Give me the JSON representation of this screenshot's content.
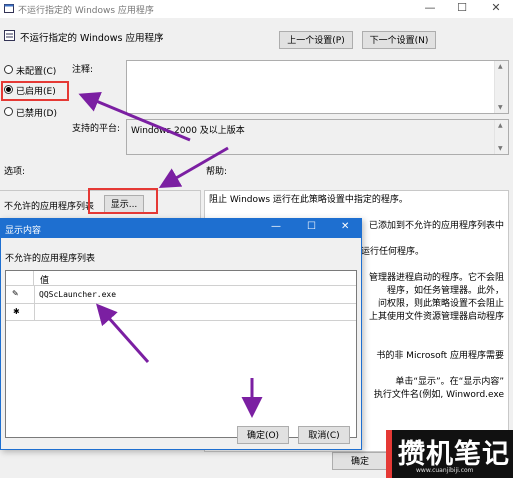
{
  "window": {
    "title": "不运行指定的 Windows 应用程序",
    "minimize_glyph": "—",
    "maximize_glyph": "☐",
    "close_glyph": "✕"
  },
  "policy": {
    "heading": "不运行指定的 Windows 应用程序",
    "prev_setting_label": "上一个设置(P)",
    "next_setting_label": "下一个设置(N)",
    "radio_options": [
      {
        "label": "未配置(C)",
        "selected": false
      },
      {
        "label": "已启用(E)",
        "selected": true
      },
      {
        "label": "已禁用(D)",
        "selected": false
      }
    ],
    "comment_label": "注释:",
    "platform_label": "支持的平台:",
    "platform_value": "Windows 2000 及以上版本",
    "options_label": "选项:",
    "help_label": "帮助:",
    "disallowed_list_label": "不允许的应用程序列表",
    "show_button_label": "显示...",
    "help_text_lines": [
      "阻止 Windows 运行在此策略设置中指定的程序。",
      "",
      "已添加到不允许的应用程序列表中",
      "",
      "可以运行任何程序。",
      "",
      "管理器进程启动的程序。它不会阻",
      "程序，如任务管理器。此外，",
      "问权限，则此策略设置不会阻止",
      "上其使用文件资源管理器启动程序",
      "",
      "",
      "书的非 Microsoft 应用程序需要",
      "",
      "单击“显示”。在“显示内容”",
      "执行文件名(例如, Winword.exe"
    ],
    "ok_label": "确定"
  },
  "dialog": {
    "title": "显示内容",
    "list_label": "不允许的应用程序列表",
    "column_header": "值",
    "rows": [
      {
        "marker": "✎",
        "value": "QQScLauncher.exe"
      },
      {
        "marker": "✱",
        "value": ""
      }
    ],
    "ok_label": "确定(O)",
    "cancel_label": "取消(C)",
    "minimize_glyph": "—",
    "maximize_glyph": "☐",
    "close_glyph": "✕"
  },
  "watermark": {
    "text": "攒机笔记",
    "url": "www.cuanjibiji.com"
  },
  "colors": {
    "accent_blue": "#1e6fd0",
    "highlight_red": "#e53935",
    "arrow_purple": "#7b1fa2"
  }
}
